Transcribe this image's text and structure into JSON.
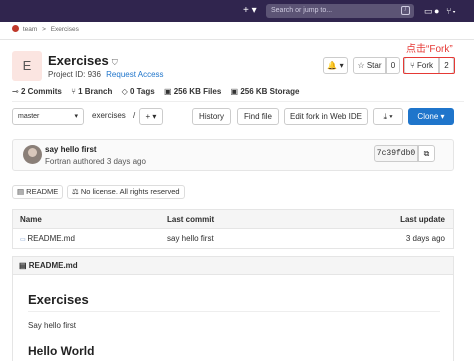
{
  "topbar": {
    "plus": "+ ▾",
    "search_placeholder": "Search or jump to...",
    "search_key": "/",
    "icons": [
      "plus-icon",
      "search-icon",
      "issues-icon",
      "merge-request-icon"
    ]
  },
  "breadcrumb": {
    "group": "team",
    "sep": ">",
    "project": "Exercises"
  },
  "project": {
    "avatar_letter": "E",
    "title": "Exercises",
    "visibility_icon": "⛉",
    "id_label": "Project ID: 936",
    "request_access": "Request Access"
  },
  "actions": {
    "notify": "🔔 ▾",
    "star_label": "☆ Star",
    "star_count": "0",
    "fork_label": "Fork",
    "fork_count": "2"
  },
  "annotation": "点击“Fork”",
  "stats": {
    "commits": "2 Commits",
    "branch": "1 Branch",
    "tags": "0 Tags",
    "files": "256 KB Files",
    "storage": "256 KB Storage"
  },
  "toolbar": {
    "branch": "master",
    "branch_caret": "▾",
    "path": "exercises",
    "path_sep": "/",
    "add": "+ ▾",
    "history": "History",
    "find_file": "Find file",
    "web_ide": "Edit fork in Web IDE",
    "download": "⤓ ▾",
    "clone": "Clone ▾"
  },
  "commit": {
    "message": "say hello first",
    "meta": "Fortran authored 3 days ago",
    "sha": "7c39fdb0",
    "copy": "⧉"
  },
  "pills": {
    "readme": "README",
    "license": "No license. All rights reserved"
  },
  "files_table": {
    "headers": {
      "name": "Name",
      "last_commit": "Last commit",
      "last_update": "Last update"
    },
    "rows": [
      {
        "name": "README.md",
        "last_commit": "say hello first",
        "last_update": "3 days ago"
      }
    ]
  },
  "readme": {
    "header": "README.md",
    "h1": "Exercises",
    "p": "Say hello first",
    "h2": "Hello World"
  },
  "colors": {
    "topbar": "#30254e",
    "link": "#1f75cb",
    "primary_button": "#1f75cb",
    "annotation": "#e53935"
  }
}
